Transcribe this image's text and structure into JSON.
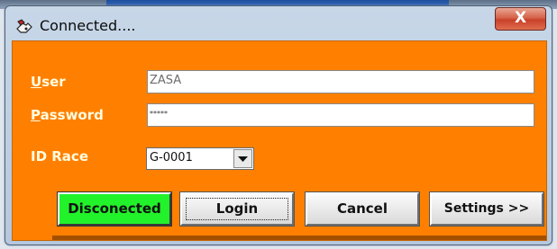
{
  "window": {
    "title": "Connected...."
  },
  "form": {
    "user": {
      "label_first": "U",
      "label_rest": "ser",
      "value": "ZASA"
    },
    "password": {
      "label_first": "P",
      "label_rest": "assword",
      "value": "*****"
    },
    "id_race": {
      "label": "ID Race",
      "selected": "G-0001"
    }
  },
  "buttons": {
    "disconnect": "Disconected",
    "login": "Login",
    "cancel": "Cancel",
    "settings": "Settings >>",
    "close": "X"
  },
  "colors": {
    "client_bg": "#ff8000",
    "status_green": "#22f22a",
    "close_red": "#c8412a",
    "label_text": "#fffde0"
  },
  "icons": {
    "title": "key-hand-icon",
    "dropdown": "chevron-down-icon"
  }
}
